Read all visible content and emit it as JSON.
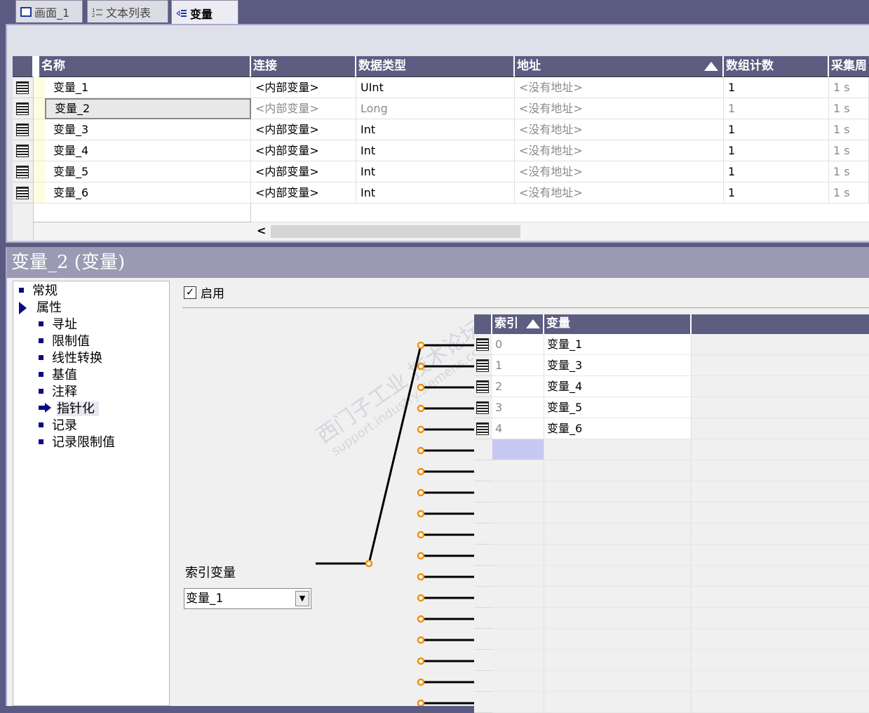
{
  "tabs": [
    {
      "label": "画面_1",
      "icon": "screen-icon"
    },
    {
      "label": "文本列表",
      "icon": "text-list-icon"
    },
    {
      "label": "变量",
      "icon": "tag-icon"
    }
  ],
  "tag_table": {
    "columns": [
      "名称",
      "连接",
      "数据类型",
      "地址",
      "数组计数",
      "采集周"
    ],
    "rows": [
      {
        "name": "变量_1",
        "connection": "<内部变量>",
        "type": "UInt",
        "address": "<没有地址>",
        "count": "1",
        "cycle": "1 s"
      },
      {
        "name": "变量_2",
        "connection": "<内部变量>",
        "type": "Long",
        "address": "<没有地址>",
        "count": "1",
        "cycle": "1 s"
      },
      {
        "name": "变量_3",
        "connection": "<内部变量>",
        "type": "Int",
        "address": "<没有地址>",
        "count": "1",
        "cycle": "1 s"
      },
      {
        "name": "变量_4",
        "connection": "<内部变量>",
        "type": "Int",
        "address": "<没有地址>",
        "count": "1",
        "cycle": "1 s"
      },
      {
        "name": "变量_5",
        "connection": "<内部变量>",
        "type": "Int",
        "address": "<没有地址>",
        "count": "1",
        "cycle": "1 s"
      },
      {
        "name": "变量_6",
        "connection": "<内部变量>",
        "type": "Int",
        "address": "<没有地址>",
        "count": "1",
        "cycle": "1 s"
      }
    ],
    "selected_row": 1,
    "scroll_left_label": "<"
  },
  "properties": {
    "title": "变量_2 (变量)",
    "tree": [
      {
        "label": "常规",
        "level": 0,
        "marker": "bullet"
      },
      {
        "label": "属性",
        "level": 0,
        "marker": "expanded"
      },
      {
        "label": "寻址",
        "level": 1,
        "marker": "bullet"
      },
      {
        "label": "限制值",
        "level": 1,
        "marker": "bullet"
      },
      {
        "label": "线性转换",
        "level": 1,
        "marker": "bullet"
      },
      {
        "label": "基值",
        "level": 1,
        "marker": "bullet"
      },
      {
        "label": "注释",
        "level": 1,
        "marker": "bullet"
      },
      {
        "label": "指针化",
        "level": 1,
        "marker": "selected"
      },
      {
        "label": "记录",
        "level": 1,
        "marker": "bullet"
      },
      {
        "label": "记录限制值",
        "level": 1,
        "marker": "bullet"
      }
    ],
    "enable_label": "启用",
    "enable_checked": true,
    "index_var_label": "索引变量",
    "index_var_value": "变量_1",
    "mux_columns": [
      "索引",
      "变量"
    ],
    "mux_rows": [
      {
        "index": "0",
        "tag": "变量_1"
      },
      {
        "index": "1",
        "tag": "变量_3"
      },
      {
        "index": "2",
        "tag": "变量_4"
      },
      {
        "index": "3",
        "tag": "变量_5"
      },
      {
        "index": "4",
        "tag": "变量_6"
      }
    ],
    "selected_input": 0
  },
  "colors": {
    "header": "#5d5d82",
    "wire": "#000000",
    "pin": "#f0900a",
    "selection": "#c8c8f4"
  }
}
